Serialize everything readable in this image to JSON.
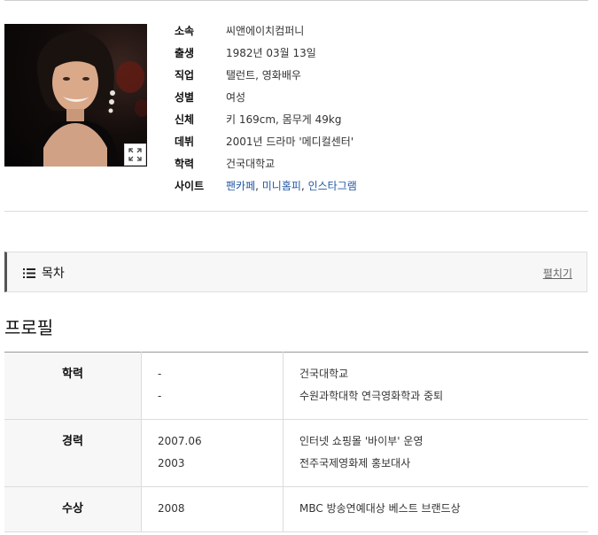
{
  "photo": {
    "alt": "profile-photo"
  },
  "info": [
    {
      "key": "소속",
      "value": "씨앤에이치컴퍼니"
    },
    {
      "key": "출생",
      "value": "1982년 03월 13일"
    },
    {
      "key": "직업",
      "value": "탤런트, 영화배우"
    },
    {
      "key": "성별",
      "value": "여성"
    },
    {
      "key": "신체",
      "value": "키 169cm, 몸무게 49kg"
    },
    {
      "key": "데뷔",
      "value": "2001년 드라마 '메디컬센터'"
    },
    {
      "key": "학력",
      "value": "건국대학교"
    },
    {
      "key": "사이트",
      "links": [
        "팬카페",
        "미니홈피",
        "인스타그램"
      ],
      "separator": ", "
    }
  ],
  "toc": {
    "title": "목차",
    "toggle": "펼치기"
  },
  "profile": {
    "heading": "프로필",
    "rows": [
      {
        "label": "학력",
        "dates": [
          "-",
          "-"
        ],
        "items": [
          "건국대학교",
          "수원과학대학 연극영화학과 중퇴"
        ]
      },
      {
        "label": "경력",
        "dates": [
          "2007.06",
          "2003"
        ],
        "items": [
          "인터넷 쇼핑몰 '바이부' 운영",
          "전주국제영화제 홍보대사"
        ]
      },
      {
        "label": "수상",
        "dates": [
          "2008"
        ],
        "items": [
          "MBC 방송연예대상 베스트 브랜드상"
        ]
      }
    ]
  }
}
